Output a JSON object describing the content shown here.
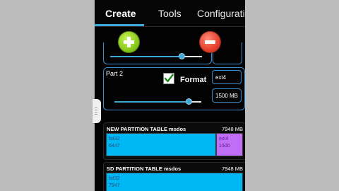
{
  "tabs": [
    "Create",
    "Tools",
    "Configurati"
  ],
  "partition1": {
    "slider_fraction": 0.78
  },
  "partition2": {
    "label": "Part 2",
    "format_label": "Format",
    "format_checked": true,
    "filesystem": "ext4",
    "size": "1500 MB",
    "slider_fraction": 0.85
  },
  "new_table": {
    "title": "NEW PARTITION TABLE msdos",
    "size": "7948 MB",
    "segments": [
      {
        "fs": "fat32",
        "size": "6447",
        "color": "#00b7f5"
      },
      {
        "fs": "ext4",
        "size": "1500",
        "color": "#c06ef5"
      }
    ]
  },
  "sd_table": {
    "title": "SD PARTITION TABLE msdos",
    "size": "7948 MB",
    "segments": [
      {
        "fs": "fat32",
        "size": "7947",
        "color": "#00b7f5"
      }
    ]
  },
  "icons": {
    "add": "plus-circle-icon",
    "remove": "minus-circle-icon",
    "check": "checkmark-icon"
  },
  "colors": {
    "accent": "#3fa7d8",
    "add": "#8ccc1d",
    "remove": "#e8432e",
    "fat32": "#00b7f5",
    "ext4": "#c06ef5"
  }
}
